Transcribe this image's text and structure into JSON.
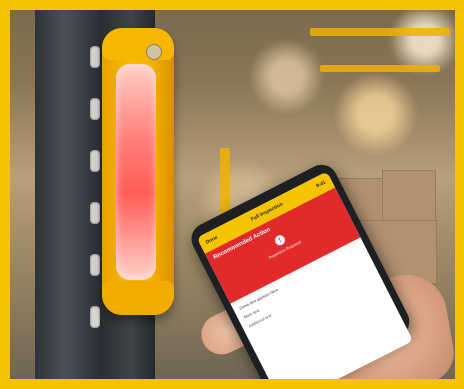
{
  "scene": {
    "description_visible": true
  },
  "phone": {
    "status_time": "9:41",
    "app_bar": {
      "left_action": "Done",
      "title": "Full Inspection"
    },
    "alert": {
      "heading": "Recommended Action",
      "badge": "!",
      "subtext": "Inspection Required"
    },
    "body": {
      "p1": "Some text appears here",
      "p2": "More text",
      "p3": "Additional text"
    }
  },
  "colors": {
    "frame": "#f5c400",
    "device": "#ffbd00",
    "device_light": "#ff5d57",
    "alert_bg": "#e22a2a",
    "app_bar_bg": "#f5c400"
  }
}
